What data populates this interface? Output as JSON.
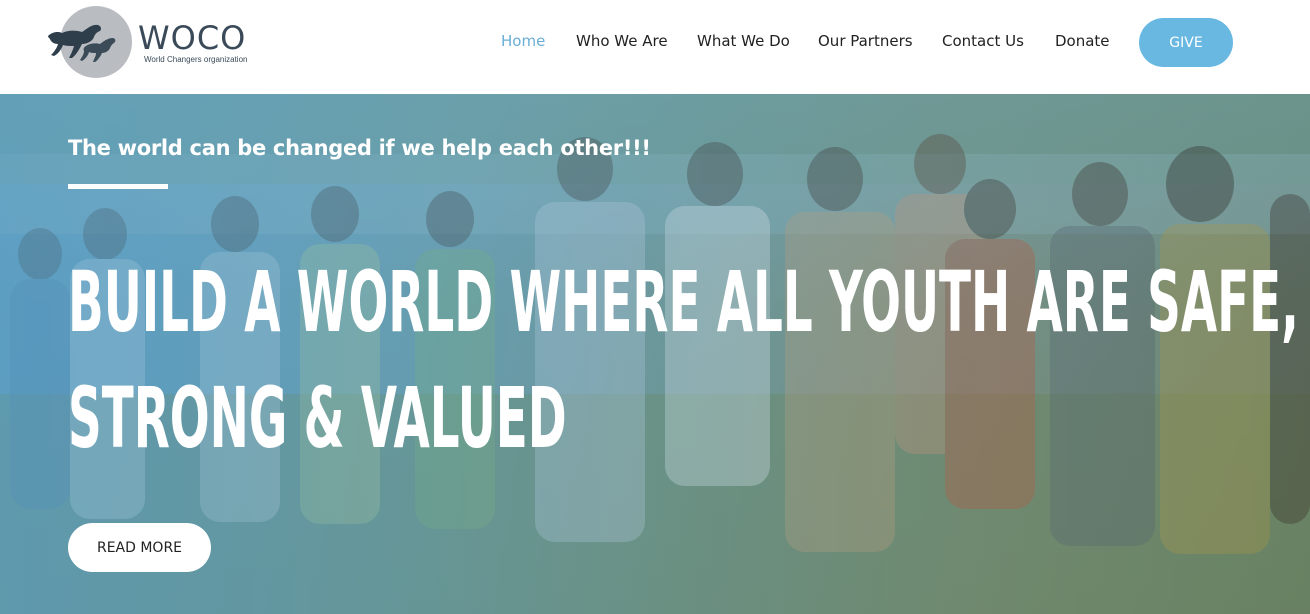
{
  "brand": {
    "title": "WOCO",
    "subtitle": "World Changers organization",
    "icon": "horses-logo-icon",
    "circle_color": "#b9bcc0",
    "text_color": "#3a4a58"
  },
  "nav": {
    "items": [
      {
        "label": "Home",
        "active": true
      },
      {
        "label": "Who We Are",
        "active": false
      },
      {
        "label": "What We Do",
        "active": false
      },
      {
        "label": "Our Partners",
        "active": false
      },
      {
        "label": "Contact Us",
        "active": false
      },
      {
        "label": "Donate",
        "active": false
      }
    ],
    "give_label": "GIVE",
    "active_color": "#6aaed6",
    "give_color": "#69b8e2"
  },
  "hero": {
    "tagline": "The world can be changed if we help each other!!!",
    "headline_line1": "Build a world where all youth are safe,",
    "headline_line2": "strong & valued",
    "read_more_label": "READ MORE",
    "background": "group-photo-of-people-outdoors"
  }
}
